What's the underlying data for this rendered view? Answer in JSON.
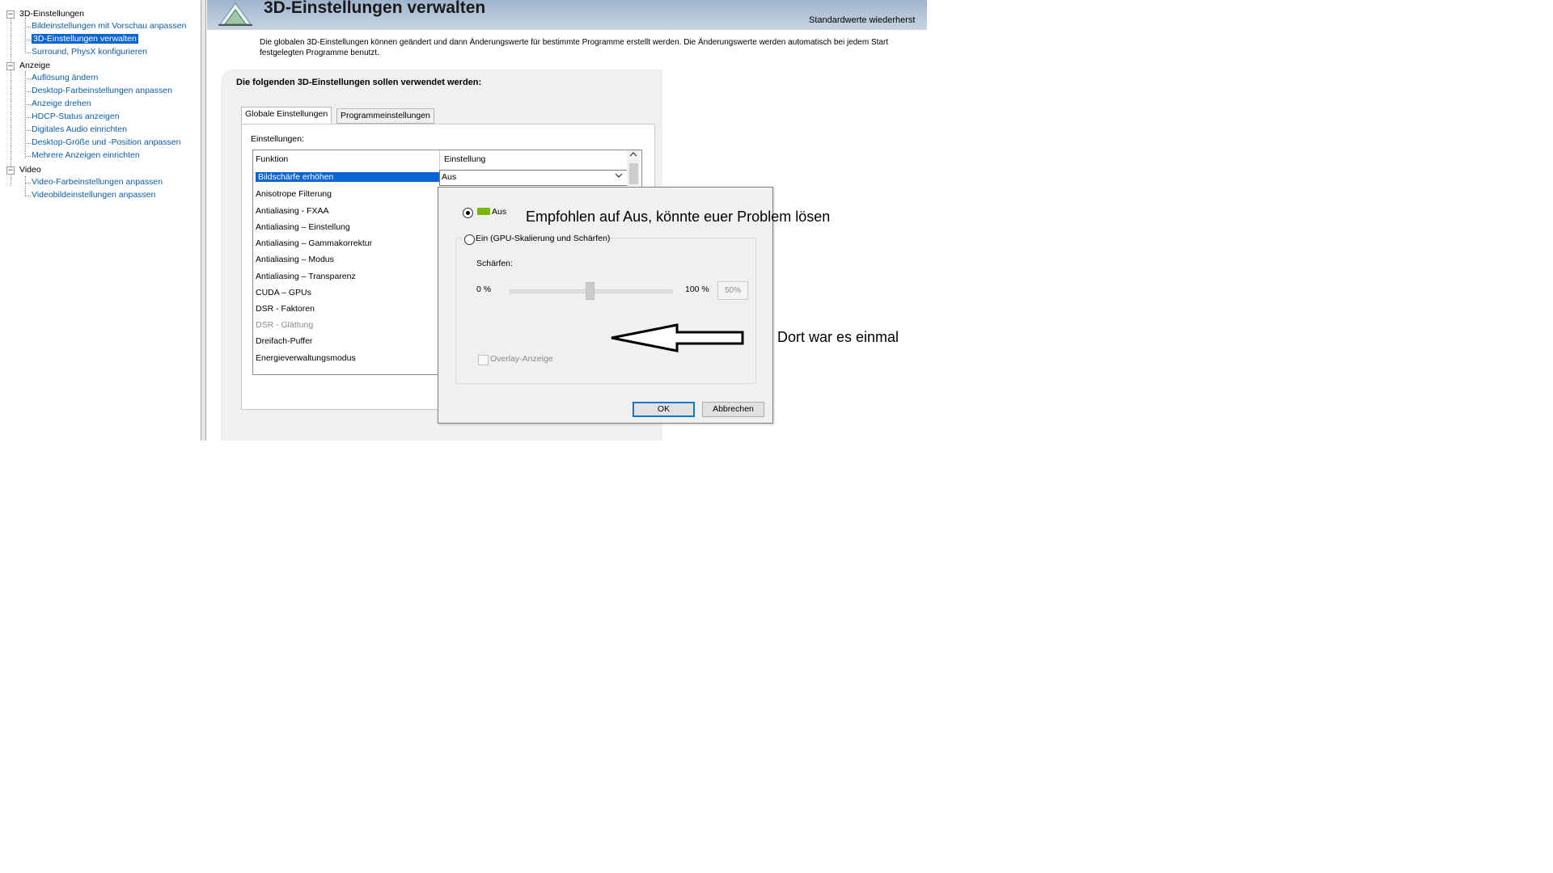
{
  "sidebar": {
    "categories": [
      {
        "label": "3D-Einstellungen",
        "items": [
          "Bildeinstellungen mit Vorschau anpassen",
          "3D-Einstellungen verwalten",
          "Surround, PhysX konfigurieren"
        ]
      },
      {
        "label": "Anzeige",
        "items": [
          "Auflösung ändern",
          "Desktop-Farbeinstellungen anpassen",
          "Anzeige drehen",
          "HDCP-Status anzeigen",
          "Digitales Audio einrichten",
          "Desktop-Größe und -Position anpassen",
          "Mehrere Anzeigen einrichten"
        ]
      },
      {
        "label": "Video",
        "items": [
          "Video-Farbeinstellungen anpassen",
          "Videobildeinstellungen anpassen"
        ]
      }
    ],
    "expander_symbol": "−"
  },
  "header": {
    "title": "3D-Einstellungen verwalten",
    "restore_link": "Standardwerte wiederherst"
  },
  "description": "Die globalen 3D-Einstellungen können geändert und dann Änderungswerte für bestimmte Programme erstellt werden. Die Änderungswerte werden automatisch bei jedem Start\nfestgelegten Programme benutzt.",
  "panel": {
    "title": "Die folgenden 3D-Einstellungen sollen verwendet werden:",
    "tabs": [
      "Globale Einstellungen",
      "Programmeinstellungen"
    ],
    "settings_label": "Einstellungen:",
    "columns": [
      "Funktion",
      "Einstellung"
    ],
    "rows": [
      "Bildschärfe erhöhen",
      "Anisotrope Filterung",
      "Antialiasing - FXAA",
      "Antialiasing – Einstellung",
      "Antialiasing – Gammakorrektur",
      "Antialiasing – Modus",
      "Antialiasing – Transparenz",
      "CUDA – GPUs",
      "DSR - Faktoren",
      "DSR - Glättung",
      "Dreifach-Puffer",
      "Energieverwaltungsmodus"
    ],
    "selected_value": "Aus"
  },
  "popup": {
    "radio_off": "Aus",
    "radio_on": "Ein (GPU-Skalierung und Schärfen)",
    "sharpen_label": "Schärfen:",
    "slider_min": "0 %",
    "slider_max": "100 %",
    "slider_value": "50%",
    "overlay_label": "Overlay-Anzeige",
    "ok": "OK",
    "cancel": "Abbrechen"
  },
  "annotations": {
    "note1": "Empfohlen auf Aus, könnte euer Problem lösen",
    "note2": "Dort war es einmal"
  },
  "colors": {
    "selection": "#0a64d4",
    "link": "#0b5ea8",
    "nvidia_green": "#76b900"
  }
}
